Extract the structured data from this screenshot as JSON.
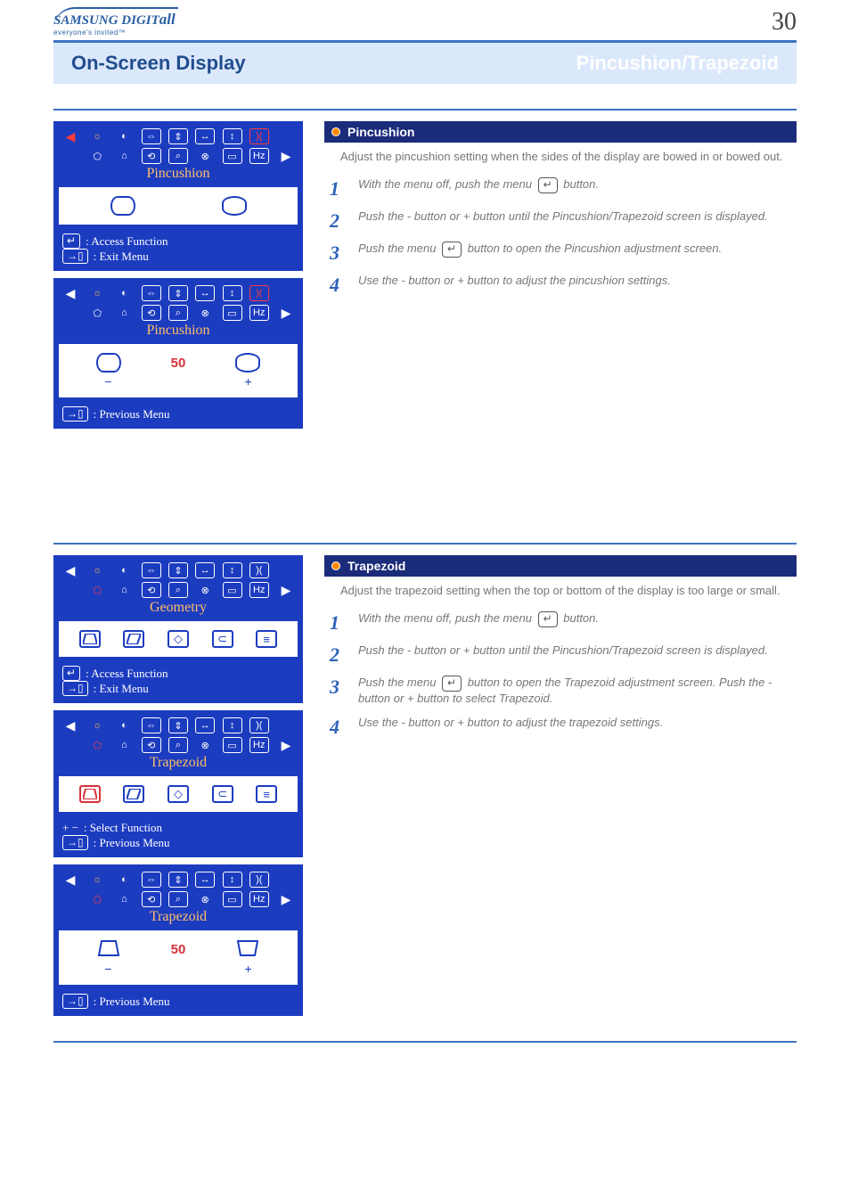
{
  "logo": {
    "brand": "SAMSUNG DIGIT",
    "suffix": "all",
    "tagline": "everyone's invited™"
  },
  "page_number": "30",
  "title": {
    "left": "On-Screen Display",
    "right": "Pincushion/Trapezoid"
  },
  "osd1": {
    "label": "Pincushion",
    "access_line": ": Access Function",
    "exit_line": ": Exit Menu"
  },
  "osd2": {
    "label": "Pincushion",
    "value": "50",
    "minus": "−",
    "plus": "+",
    "prev_line": ": Previous Menu"
  },
  "pincushion": {
    "header": "Pincushion",
    "desc": "Adjust the pincushion setting when the sides of the display are bowed in or bowed out.",
    "steps": {
      "s1a": "With the menu off, push the menu",
      "s1b": "button.",
      "s2": "Push the - button or + button until the Pincushion/Trapezoid screen is displayed.",
      "s3a": "Push the menu",
      "s3b": "button to open the Pincushion adjustment screen.",
      "s4": "Use the - button or + button to adjust the pincushion settings."
    }
  },
  "osd3": {
    "label": "Geometry",
    "access_line": ": Access Function",
    "exit_line": ": Exit Menu"
  },
  "osd4": {
    "label": "Trapezoid",
    "select_line": ": Select Function",
    "prev_line": ": Previous Menu"
  },
  "osd5": {
    "label": "Trapezoid",
    "value": "50",
    "minus": "−",
    "plus": "+",
    "prev_line": ": Previous Menu"
  },
  "trapezoid": {
    "header": "Trapezoid",
    "desc": "Adjust the trapezoid setting when the top or bottom of the display is too large or small.",
    "steps": {
      "s1a": "With the menu off, push the menu",
      "s1b": "button.",
      "s2": "Push the - button or + button until the Pincushion/Trapezoid screen is displayed.",
      "s3a": "Push the menu",
      "s3b": "button to open the Trapezoid adjustment screen. Push the - button or + button to select Trapezoid.",
      "s4": "Use the - button or + button to adjust the trapezoid settings."
    }
  }
}
